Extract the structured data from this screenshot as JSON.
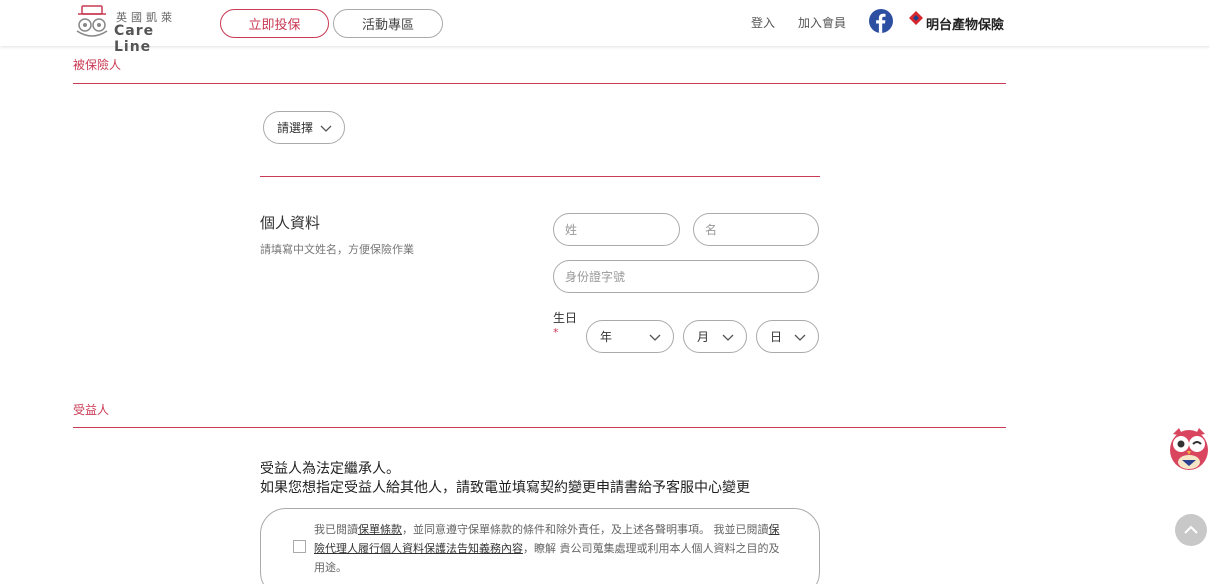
{
  "header": {
    "logo_cn": "英國凱萊",
    "logo_en": "Care Line",
    "buy_now": "立即投保",
    "events": "活動專區",
    "login": "登入",
    "join": "加入會員",
    "brand_name": "明台產物保險"
  },
  "insured": {
    "section_title": "被保險人",
    "relation_select": "請選擇",
    "personal_title": "個人資料",
    "personal_subtitle": "請填寫中文姓名，方便保險作業",
    "surname_placeholder": "姓",
    "given_name_placeholder": "名",
    "id_placeholder": "身份證字號",
    "birthday_label": "生日",
    "required_mark": "*",
    "year_select": "年",
    "month_select": "月",
    "day_select": "日"
  },
  "beneficiary": {
    "section_title": "受益人",
    "line1": "受益人為法定繼承人。",
    "line2": "如果您想指定受益人給其他人，請致電並填寫契約變更申請書給予客服中心變更"
  },
  "agreement": {
    "part1": "我已閱讀",
    "link1": "保單條款",
    "part2": "，並同意遵守保單條款的條件和除外責任，及上述各聲明事項。 我並已閱讀",
    "link2": "保險代理人履行個人資料保護法告知義務內容",
    "part3": "，瞭解 貴公司蒐集處理或利用本人個人資料之目的及用途。"
  },
  "colors": {
    "accent": "#c93a53",
    "border": "#aaaaaa",
    "facebook": "#2d4fa1"
  }
}
